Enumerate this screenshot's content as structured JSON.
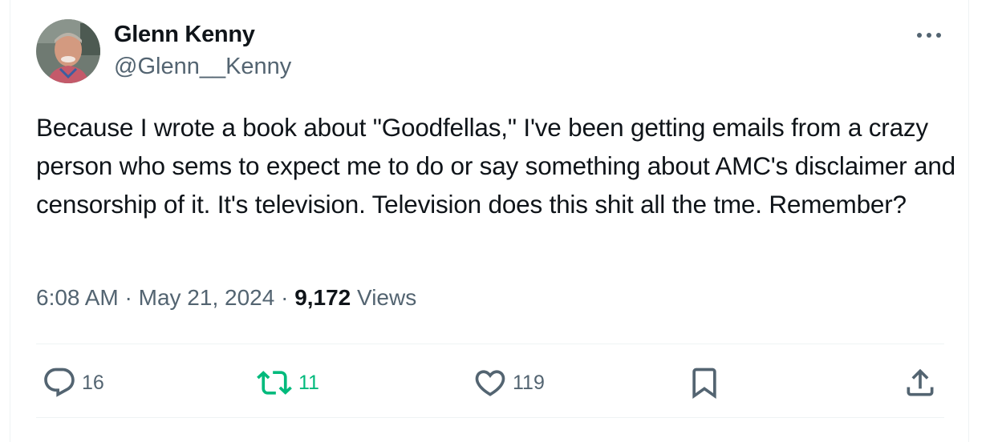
{
  "author": {
    "name": "Glenn Kenny",
    "handle": "@Glenn__Kenny"
  },
  "tweet": {
    "text": "Because I wrote a book about \"Goodfellas,\" I've been getting emails from a crazy person who sems to expect me to do or say something about AMC's disclaimer and censorship of it. It's television. Television does this shit all the tme. Remember?",
    "time": "6:08 AM",
    "separator": " · ",
    "date": "May 21, 2024",
    "views_count": "9,172",
    "views_label": " Views"
  },
  "actions": {
    "replies": "16",
    "retweets": "11",
    "likes": "119"
  },
  "icons": {
    "more": "more-horizontal-icon",
    "reply": "reply-icon",
    "retweet": "retweet-icon",
    "like": "heart-icon",
    "bookmark": "bookmark-icon",
    "share": "share-icon"
  },
  "colors": {
    "text_primary": "#0f1419",
    "text_secondary": "#536471",
    "retweet_active": "#00ba7c",
    "divider": "#eff3f4"
  }
}
